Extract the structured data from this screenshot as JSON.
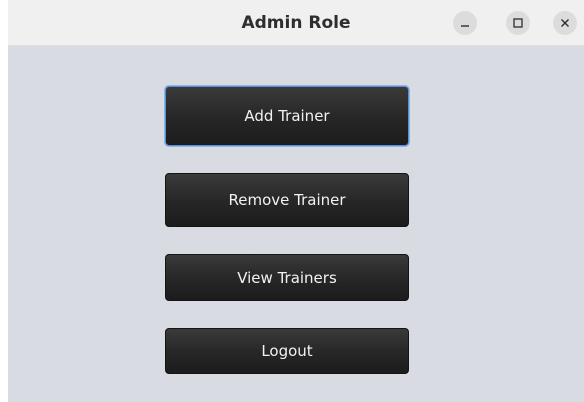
{
  "window": {
    "title": "Admin Role",
    "controls": {
      "minimize": "minimize-icon",
      "maximize": "maximize-icon",
      "close": "close-icon"
    }
  },
  "menu": {
    "buttons": [
      {
        "label": "Add Trainer",
        "focused": true
      },
      {
        "label": "Remove Trainer",
        "focused": false
      },
      {
        "label": "View Trainers",
        "focused": false
      },
      {
        "label": "Logout",
        "focused": false
      }
    ]
  },
  "colors": {
    "background": "#d8dbe2",
    "button": "#262626",
    "button_text": "#f2f2f2",
    "focus_ring": "#5a8fd6"
  }
}
